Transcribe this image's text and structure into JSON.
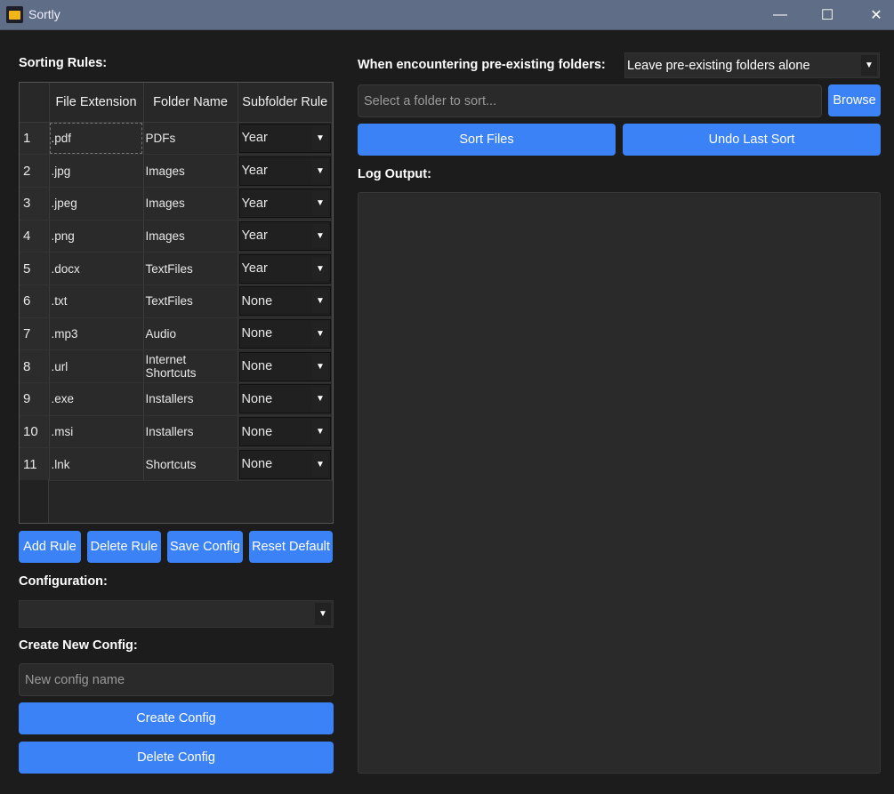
{
  "window": {
    "title": "Sortly",
    "minimize": "—",
    "maximize": "☐",
    "close": "✕"
  },
  "left": {
    "sorting_rules_label": "Sorting Rules:",
    "columns": [
      "File Extension",
      "Folder Name",
      "Subfolder Rule"
    ],
    "rows": [
      {
        "n": "1",
        "ext": ".pdf",
        "folder": "PDFs",
        "rule": "Year"
      },
      {
        "n": "2",
        "ext": ".jpg",
        "folder": "Images",
        "rule": "Year"
      },
      {
        "n": "3",
        "ext": ".jpeg",
        "folder": "Images",
        "rule": "Year"
      },
      {
        "n": "4",
        "ext": ".png",
        "folder": "Images",
        "rule": "Year"
      },
      {
        "n": "5",
        "ext": ".docx",
        "folder": "TextFiles",
        "rule": "Year"
      },
      {
        "n": "6",
        "ext": ".txt",
        "folder": "TextFiles",
        "rule": "None"
      },
      {
        "n": "7",
        "ext": ".mp3",
        "folder": "Audio",
        "rule": "None"
      },
      {
        "n": "8",
        "ext": ".url",
        "folder": "Internet Shortcuts",
        "rule": "None"
      },
      {
        "n": "9",
        "ext": ".exe",
        "folder": "Installers",
        "rule": "None"
      },
      {
        "n": "10",
        "ext": ".msi",
        "folder": "Installers",
        "rule": "None"
      },
      {
        "n": "11",
        "ext": ".lnk",
        "folder": "Shortcuts",
        "rule": "None"
      }
    ],
    "add_rule": "Add Rule",
    "delete_rule": "Delete Rule",
    "save_config": "Save Config",
    "reset_default": "Reset Default",
    "configuration_label": "Configuration:",
    "configuration_value": "",
    "create_new_label": "Create New Config:",
    "new_config_placeholder": "New config name",
    "create_config": "Create Config",
    "delete_config": "Delete Config"
  },
  "right": {
    "preexisting_label": "When encountering pre-existing folders:",
    "preexisting_value": "Leave pre-existing folders alone",
    "folder_placeholder": "Select a folder to sort...",
    "browse": "Browse",
    "sort_files": "Sort Files",
    "undo": "Undo Last Sort",
    "log_label": "Log Output:"
  }
}
